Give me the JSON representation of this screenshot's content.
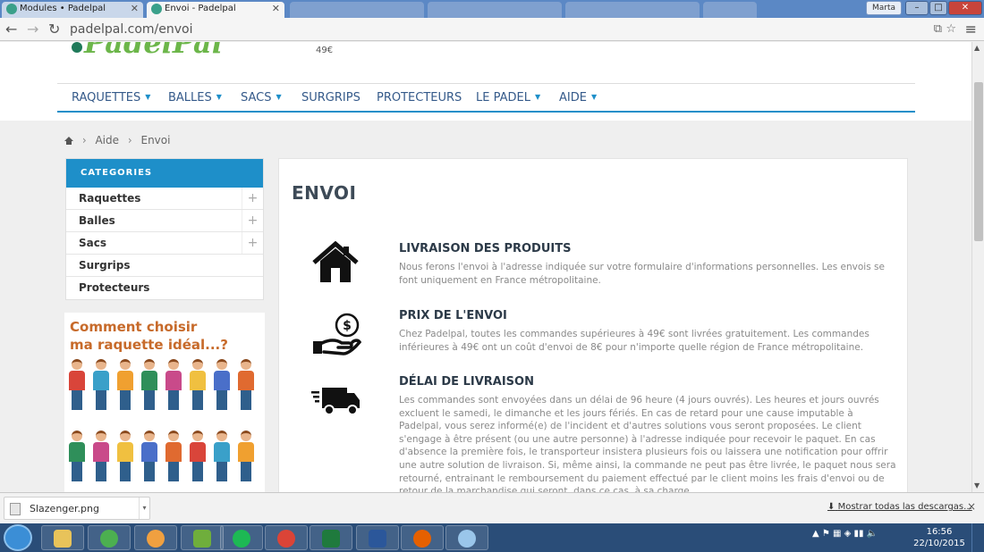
{
  "browser": {
    "tabs": [
      {
        "title": "Modules • Padelpal"
      },
      {
        "title": "Envoi - Padelpal"
      },
      {
        "title": ""
      },
      {
        "title": ""
      },
      {
        "title": ""
      },
      {
        "title": ""
      }
    ],
    "user": "Marta",
    "window_controls": {
      "minimize": "–",
      "maximize": "□",
      "close": "✕"
    },
    "back": "←",
    "forward": "→",
    "reload": "↻",
    "url": "padelpal.com/envoi",
    "menu": "≡",
    "star": "☆",
    "translate": "⧉"
  },
  "header": {
    "logo_text": "PadelPal",
    "price": "49€"
  },
  "nav": [
    {
      "label": "RAQUETTES",
      "caret": true
    },
    {
      "label": "BALLES",
      "caret": true
    },
    {
      "label": "SACS",
      "caret": true
    },
    {
      "label": "SURGRIPS",
      "caret": false
    },
    {
      "label": "PROTECTEURS",
      "caret": false
    },
    {
      "label": "LE PADEL",
      "caret": true
    },
    {
      "label": "AIDE",
      "caret": true
    }
  ],
  "caret_glyph": "▼",
  "breadcrumb": {
    "sep": "›",
    "items": [
      "Aide",
      "Envoi"
    ]
  },
  "categories": {
    "title": "CATEGORIES",
    "plus": "+",
    "items": [
      {
        "label": "Raquettes",
        "expandable": true
      },
      {
        "label": "Balles",
        "expandable": true
      },
      {
        "label": "Sacs",
        "expandable": true
      },
      {
        "label": "Surgrips",
        "expandable": false
      },
      {
        "label": "Protecteurs",
        "expandable": false
      }
    ]
  },
  "promo": {
    "line1": "Comment choisir",
    "line2": "ma raquette idéal...?"
  },
  "content": {
    "title": "ENVOI",
    "sections": [
      {
        "icon": "house-icon",
        "title": "LIVRAISON DES PRODUITS",
        "body": "Nous ferons l'envoi à l'adresse indiquée sur votre formulaire d'informations personnelles. Les envois se font uniquement en France métropolitaine."
      },
      {
        "icon": "money-hand-icon",
        "title": "PRIX DE L'ENVOI",
        "body": "Chez Padelpal, toutes les commandes supérieures à 49€ sont livrées gratuitement. Les commandes inférieures à 49€ ont un coût d'envoi de 8€ pour n'importe quelle région de France métropolitaine."
      },
      {
        "icon": "delivery-truck-icon",
        "title": "DÉLAI DE LIVRAISON",
        "body": "Les commandes sont envoyées dans un délai de 96 heure (4 jours ouvrés). Les heures et jours ouvrés excluent le samedi, le dimanche et les jours fériés. En cas de retard pour une cause imputable à Padelpal, vous serez informé(e) de l'incident et d'autres solutions vous seront proposées. Le client s'engage à être présent (ou une autre personne) à l'adresse indiquée pour recevoir le paquet. En cas d'absence la première fois, le transporteur insistera plusieurs fois ou laissera une notification pour offrir une autre solution de livraison. Si, même ainsi, la commande ne peut pas être livrée, le paquet nous sera retourné, entrainant le remboursement du paiement effectué par le client moins les frais d'envoi ou de retour de la marchandise qui seront, dans ce cas, à sa charge."
      }
    ]
  },
  "scrollbar": {
    "up": "▲",
    "down": "▼"
  },
  "downloads": {
    "file": "Slazenger.png",
    "caret": "▾",
    "show_all": "Mostrar todas las descargas...",
    "show_all_icon": "⬇",
    "close": "×"
  },
  "taskbar": {
    "tray": "▲  ⚑  ▦  ◈  ▮▮  🔈",
    "time": "16:56",
    "date": "22/10/2015"
  },
  "colors": {
    "accent": "#1e8fc9",
    "nav_text": "#355a8a",
    "logo_green": "#6cb64a",
    "promo_orange": "#c76a2a"
  }
}
